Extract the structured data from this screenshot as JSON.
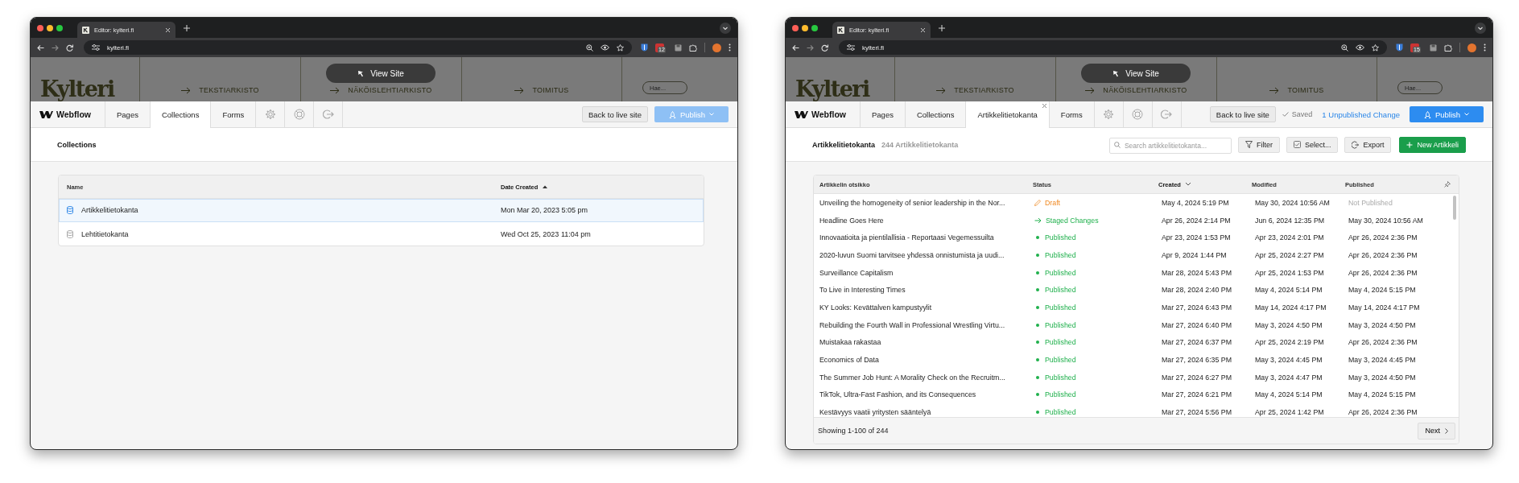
{
  "windows": [
    {
      "browser_tab": "Editor: kylteri.fi",
      "url": "kylteri.fi",
      "extension_badge": "12",
      "site": {
        "logo": "Kylteri",
        "nav": [
          "TEKSTIARKISTO",
          "NÄKÖISLEHTIARKISTO",
          "TOIMITUS"
        ],
        "search_placeholder": "Hae...",
        "view_site": "View Site"
      },
      "toolbar": {
        "brand": "Webflow",
        "tabs": [
          {
            "label": "Pages",
            "selected": false,
            "closable": false
          },
          {
            "label": "Collections",
            "selected": true,
            "closable": false
          },
          {
            "label": "Forms",
            "selected": false,
            "closable": false
          }
        ],
        "back": "Back to live site",
        "publish": {
          "label": "Publish",
          "disabled": true
        }
      },
      "view": {
        "kind": "collections",
        "title": "Collections",
        "columns": [
          {
            "label": "Name",
            "sorted": false
          },
          {
            "label": "Date Created",
            "sorted": true,
            "sort_descending": false
          }
        ],
        "rows": [
          {
            "name": "Artikkelitietokanta",
            "date_created": "Mon Mar 20, 2023 5:05 pm",
            "selected": true
          },
          {
            "name": "Lehtitietokanta",
            "date_created": "Wed Oct 25, 2023 11:04 pm",
            "selected": false
          }
        ]
      }
    },
    {
      "browser_tab": "Editor: kylteri.fi",
      "url": "kylteri.fi",
      "extension_badge": "15",
      "site": {
        "logo": "Kylteri",
        "nav": [
          "TEKSTIARKISTO",
          "NÄKÖISLEHTIARKISTO",
          "TOIMITUS"
        ],
        "search_placeholder": "Hae...",
        "view_site": "View Site"
      },
      "toolbar": {
        "brand": "Webflow",
        "tabs": [
          {
            "label": "Pages",
            "selected": false,
            "closable": false
          },
          {
            "label": "Collections",
            "selected": false,
            "closable": false
          },
          {
            "label": "Artikkelitietokanta",
            "selected": true,
            "closable": true
          },
          {
            "label": "Forms",
            "selected": false,
            "closable": false
          }
        ],
        "back": "Back to live site",
        "saved": "Saved",
        "unpublished": "1 Unpublished Change",
        "publish": {
          "label": "Publish",
          "disabled": false
        }
      },
      "view": {
        "kind": "items",
        "title": "Artikkelitietokanta",
        "count": "244 Artikkelitietokanta",
        "search_placeholder": "Search artikkelitietokanta...",
        "actions": {
          "filter": "Filter",
          "select": "Select...",
          "export": "Export",
          "new": "New Artikkeli"
        },
        "columns": [
          {
            "label": "Artikkelin otsikko",
            "sorted": false
          },
          {
            "label": "Status",
            "sorted": false
          },
          {
            "label": "Created",
            "sorted": true,
            "sort_descending": true
          },
          {
            "label": "Modified",
            "sorted": false
          },
          {
            "label": "Published",
            "sorted": false
          }
        ],
        "rows": [
          {
            "title": "Unveiling the homogeneity of senior leadership in the Nor...",
            "status": {
              "kind": "draft",
              "label": "Draft"
            },
            "created": "May 4, 2024 5:19 PM",
            "modified": "May 30, 2024 10:56 AM",
            "published": "Not Published",
            "published_muted": true
          },
          {
            "title": "Headline Goes Here",
            "status": {
              "kind": "staged",
              "label": "Staged Changes"
            },
            "created": "Apr 26, 2024 2:14 PM",
            "modified": "Jun 6, 2024 12:35 PM",
            "published": "May 30, 2024 10:56 AM",
            "published_muted": false
          },
          {
            "title": "Innovaatioita ja pientilallisia - Reportaasi Vegemessuilta",
            "status": {
              "kind": "published",
              "label": "Published"
            },
            "created": "Apr 23, 2024 1:53 PM",
            "modified": "Apr 23, 2024 2:01 PM",
            "published": "Apr 26, 2024 2:36 PM",
            "published_muted": false
          },
          {
            "title": "2020-luvun Suomi tarvitsee yhdessä onnistumista ja uudi...",
            "status": {
              "kind": "published",
              "label": "Published"
            },
            "created": "Apr 9, 2024 1:44 PM",
            "modified": "Apr 25, 2024 2:27 PM",
            "published": "Apr 26, 2024 2:36 PM",
            "published_muted": false
          },
          {
            "title": "Surveillance Capitalism",
            "status": {
              "kind": "published",
              "label": "Published"
            },
            "created": "Mar 28, 2024 5:43 PM",
            "modified": "Apr 25, 2024 1:53 PM",
            "published": "Apr 26, 2024 2:36 PM",
            "published_muted": false
          },
          {
            "title": "To Live in Interesting Times",
            "status": {
              "kind": "published",
              "label": "Published"
            },
            "created": "Mar 28, 2024 2:40 PM",
            "modified": "May 4, 2024 5:14 PM",
            "published": "May 4, 2024 5:15 PM",
            "published_muted": false
          },
          {
            "title": "KY Looks: Kevättalven kampustyylit",
            "status": {
              "kind": "published",
              "label": "Published"
            },
            "created": "Mar 27, 2024 6:43 PM",
            "modified": "May 14, 2024 4:17 PM",
            "published": "May 14, 2024 4:17 PM",
            "published_muted": false
          },
          {
            "title": "Rebuilding the Fourth Wall in Professional Wrestling Virtu...",
            "status": {
              "kind": "published",
              "label": "Published"
            },
            "created": "Mar 27, 2024 6:40 PM",
            "modified": "May 3, 2024 4:50 PM",
            "published": "May 3, 2024 4:50 PM",
            "published_muted": false
          },
          {
            "title": "Muistakaa rakastaa",
            "status": {
              "kind": "published",
              "label": "Published"
            },
            "created": "Mar 27, 2024 6:37 PM",
            "modified": "Apr 25, 2024 2:19 PM",
            "published": "Apr 26, 2024 2:36 PM",
            "published_muted": false
          },
          {
            "title": "Economics of Data",
            "status": {
              "kind": "published",
              "label": "Published"
            },
            "created": "Mar 27, 2024 6:35 PM",
            "modified": "May 3, 2024 4:45 PM",
            "published": "May 3, 2024 4:45 PM",
            "published_muted": false
          },
          {
            "title": "The Summer Job Hunt: A Morality Check on the Recruitm...",
            "status": {
              "kind": "published",
              "label": "Published"
            },
            "created": "Mar 27, 2024 6:27 PM",
            "modified": "May 3, 2024 4:47 PM",
            "published": "May 3, 2024 4:50 PM",
            "published_muted": false
          },
          {
            "title": "TikTok, Ultra-Fast Fashion, and its Consequences",
            "status": {
              "kind": "published",
              "label": "Published"
            },
            "created": "Mar 27, 2024 6:21 PM",
            "modified": "May 4, 2024 5:14 PM",
            "published": "May 4, 2024 5:15 PM",
            "published_muted": false
          },
          {
            "title": "Kestävyys vaatii yritysten sääntelyä",
            "status": {
              "kind": "published",
              "label": "Published"
            },
            "created": "Mar 27, 2024 5:56 PM",
            "modified": "Apr 25, 2024 1:42 PM",
            "published": "Apr 26, 2024 2:36 PM",
            "published_muted": false
          }
        ],
        "footer": "Showing 1-100 of 244",
        "next": "Next"
      }
    }
  ]
}
